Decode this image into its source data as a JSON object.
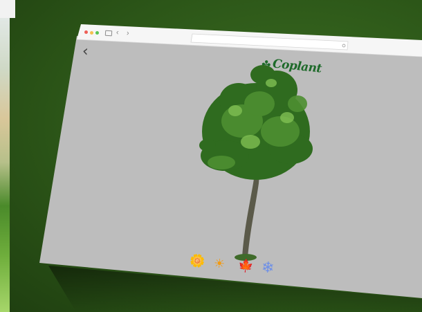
{
  "browser": {
    "traffic_lights": [
      "#ee5f57",
      "#f4bf4f",
      "#58c454"
    ],
    "address_bar": {
      "value": ""
    }
  },
  "page": {
    "back_label": "‹",
    "logo": {
      "name": "Coplant",
      "leaf_icon": "clover-icon"
    },
    "scene": "tree-3d-model",
    "season_buttons": [
      {
        "id": "spring",
        "icon": "spring-flower-icon",
        "glyph": "🌼"
      },
      {
        "id": "summer",
        "icon": "sun-icon",
        "glyph": "☀"
      },
      {
        "id": "autumn",
        "icon": "autumn-leaf-icon",
        "glyph": "🍁"
      },
      {
        "id": "winter",
        "icon": "snowflake-icon",
        "glyph": "❄"
      }
    ]
  },
  "colors": {
    "background": "#2f5a1a",
    "page_bg": "#bdbdbd",
    "toolbar": "#f5f5f5",
    "brand": "#1e6a2a"
  }
}
